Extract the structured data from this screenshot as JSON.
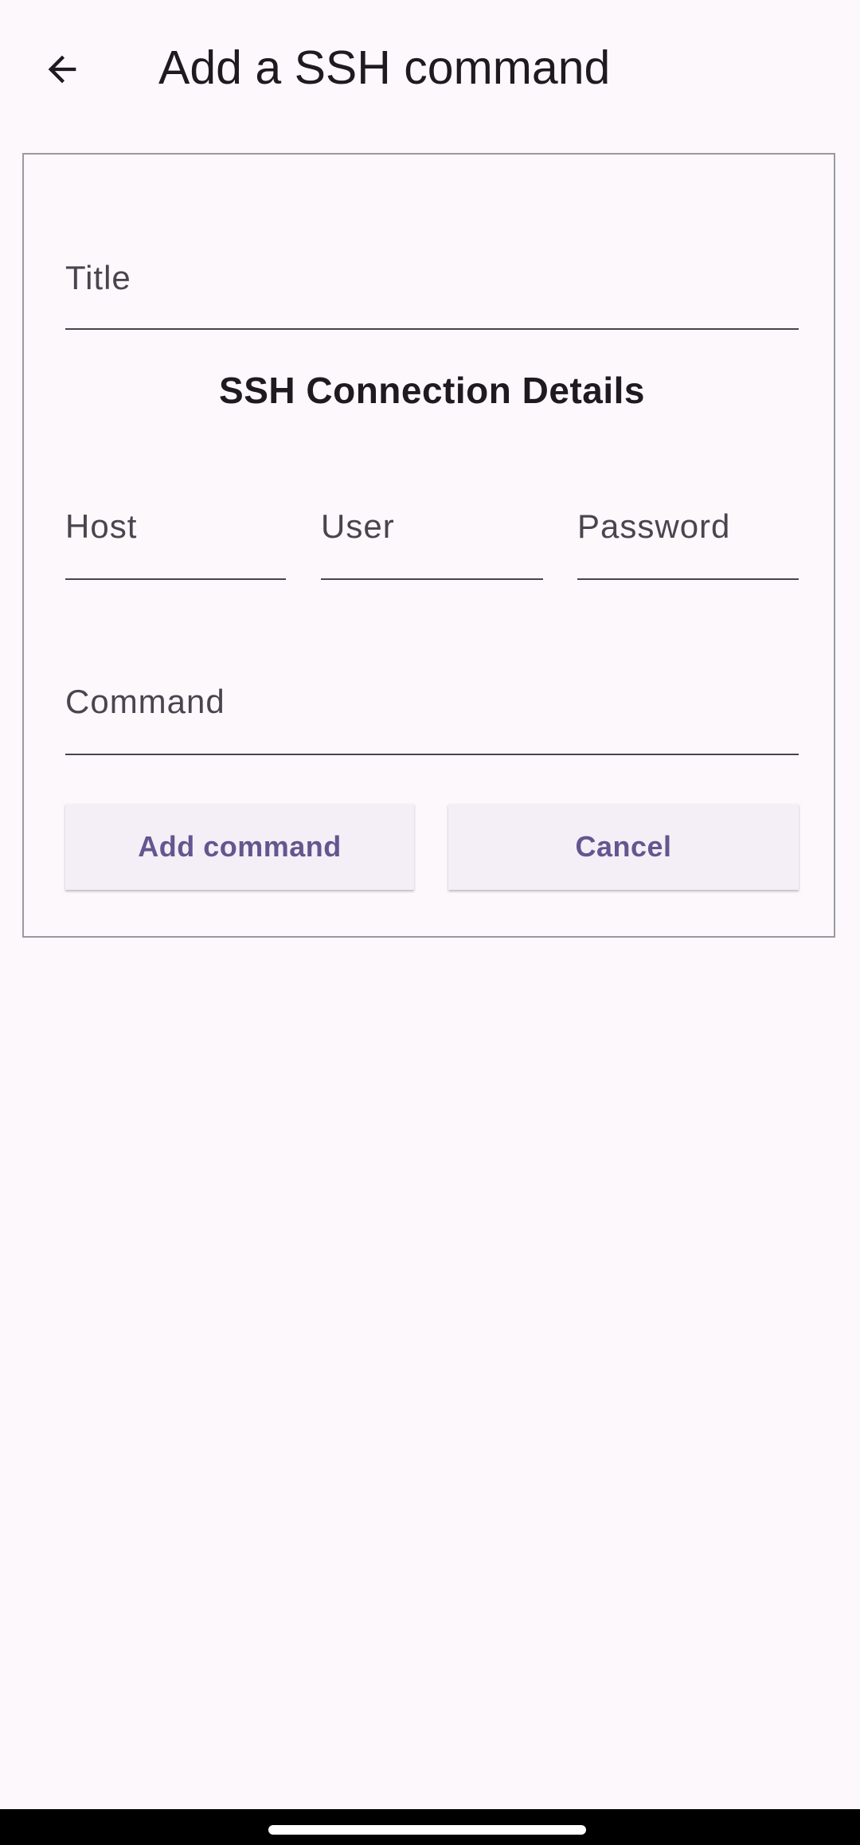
{
  "app_bar": {
    "title": "Add a SSH command",
    "back_icon": "arrow-back-icon"
  },
  "form": {
    "title_field": {
      "placeholder": "Title",
      "value": ""
    },
    "section_heading": "SSH Connection Details",
    "host_field": {
      "placeholder": "Host",
      "value": ""
    },
    "user_field": {
      "placeholder": "User",
      "value": ""
    },
    "password_field": {
      "placeholder": "Password",
      "value": ""
    },
    "command_field": {
      "placeholder": "Command",
      "value": ""
    },
    "add_button_label": "Add command",
    "cancel_button_label": "Cancel"
  },
  "colors": {
    "background": "#fdf8fc",
    "accent": "#65558f",
    "button_surface": "#f4eff6",
    "card_border": "#9a9a9e"
  }
}
